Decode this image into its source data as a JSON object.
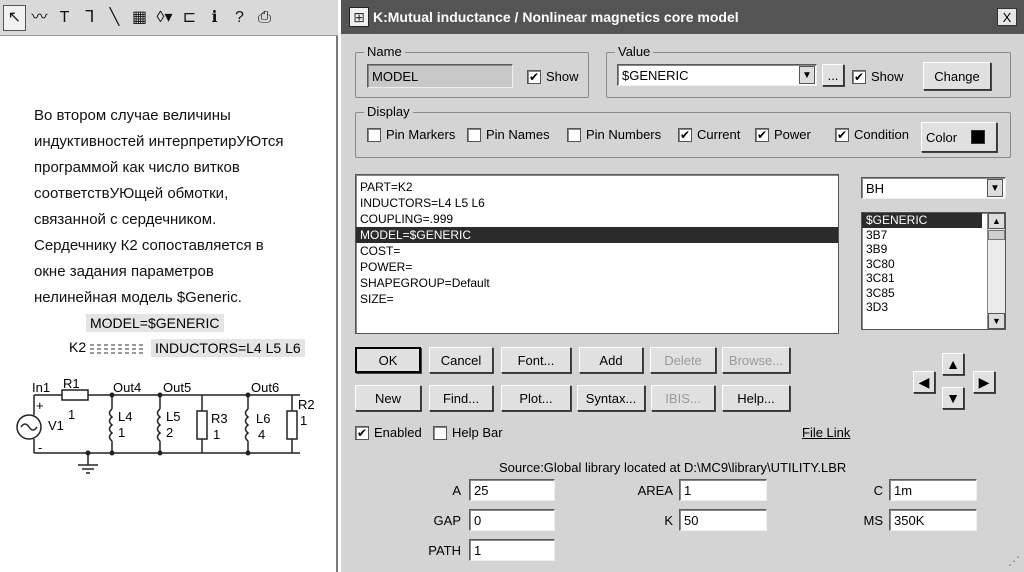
{
  "toolbar": {
    "tools": [
      {
        "icon": "select-arrow-icon",
        "glyph": "↖"
      },
      {
        "icon": "wire-icon",
        "glyph": "〰"
      },
      {
        "icon": "text-tool-icon",
        "glyph": "T"
      },
      {
        "icon": "orthogonal-wire-icon",
        "glyph": "ᒣ"
      },
      {
        "icon": "diagonal-wire-icon",
        "glyph": "╲"
      },
      {
        "icon": "info-grid-icon",
        "glyph": "▦"
      },
      {
        "icon": "shapes-dropdown-icon",
        "glyph": "◊▾"
      },
      {
        "icon": "flag-icon",
        "glyph": "⊏"
      },
      {
        "icon": "info-icon",
        "glyph": "ℹ"
      },
      {
        "icon": "help-pointer-icon",
        "glyph": "?"
      },
      {
        "icon": "printer-icon",
        "glyph": "⎙"
      }
    ]
  },
  "document": {
    "paragraph_lines": [
      "Во втором случае величины",
      "индуктивностей интерпретирУЮтся",
      "программой как число витков",
      "соответствУЮщей обмотки,",
      "связанной с сердечником.",
      "Сердечнику К2 сопоставляется в",
      "окне задания параметров",
      "нелинейная  модель $Generic."
    ]
  },
  "schematic": {
    "model_label": "MODEL=$GENERIC",
    "k2_label": "K2",
    "inductors_label": "INDUCTORS=L4 L5 L6",
    "nodes": [
      "In1",
      "R1",
      "Out4",
      "Out5",
      "Out6",
      "R2"
    ],
    "components": {
      "r1_value": "1",
      "v1": "V1",
      "plus": "+",
      "minus": "-",
      "l4": "L4",
      "l4_value": "1",
      "l5": "L5",
      "l5_value": "2",
      "r3": "R3",
      "r3_value": "1",
      "l6": "L6",
      "l6_value": "4",
      "r2_value": "1"
    }
  },
  "dialog": {
    "title": "K:Mutual inductance / Nonlinear magnetics core model",
    "close_glyph": "X",
    "name_group": {
      "legend": "Name",
      "value": "MODEL",
      "show_label": "Show",
      "show_checked": true
    },
    "value_group": {
      "legend": "Value",
      "value": "$GENERIC",
      "browse_label": "...",
      "show_label": "Show",
      "show_checked": true,
      "change_label": "Change"
    },
    "display_group": {
      "legend": "Display",
      "pin_markers": "Pin Markers",
      "pin_markers_checked": false,
      "pin_names": "Pin Names",
      "pin_names_checked": false,
      "pin_numbers": "Pin Numbers",
      "pin_numbers_checked": false,
      "current": "Current",
      "current_checked": true,
      "power": "Power",
      "power_checked": true,
      "condition": "Condition",
      "condition_checked": true,
      "color_label": "Color",
      "color_value": "#000000"
    },
    "attributes": [
      "PART=K2",
      "INDUCTORS=L4 L5 L6",
      "COUPLING=.999",
      "MODEL=$GENERIC",
      "COST=",
      "POWER=",
      "SHAPEGROUP=Default",
      "SIZE="
    ],
    "selected_attribute_index": 3,
    "model_type": "BH",
    "models": [
      "$GENERIC",
      "3B7",
      "3B9",
      "3C80",
      "3C81",
      "3C85",
      "3D3"
    ],
    "selected_model_index": 0,
    "buttons_row1": {
      "ok": "OK",
      "cancel": "Cancel",
      "font": "Font...",
      "add": "Add",
      "delete": "Delete",
      "browse": "Browse..."
    },
    "buttons_row2": {
      "new": "New",
      "find": "Find...",
      "plot": "Plot...",
      "syntax": "Syntax...",
      "ibis": "IBIS...",
      "help": "Help..."
    },
    "enabled_label": "Enabled",
    "enabled_checked": true,
    "help_bar_label": "Help Bar",
    "help_bar_checked": false,
    "file_link": "File Link",
    "source": "Source:Global library located at D:\\MC9\\library\\UTILITY.LBR",
    "params": {
      "a_label": "A",
      "a_value": "25",
      "area_label": "AREA",
      "area_value": "1",
      "c_label": "C",
      "c_value": "1m",
      "gap_label": "GAP",
      "gap_value": "0",
      "k_label": "K",
      "k_value": "50",
      "ms_label": "MS",
      "ms_value": "350K",
      "path_label": "PATH",
      "path_value": "1"
    }
  }
}
